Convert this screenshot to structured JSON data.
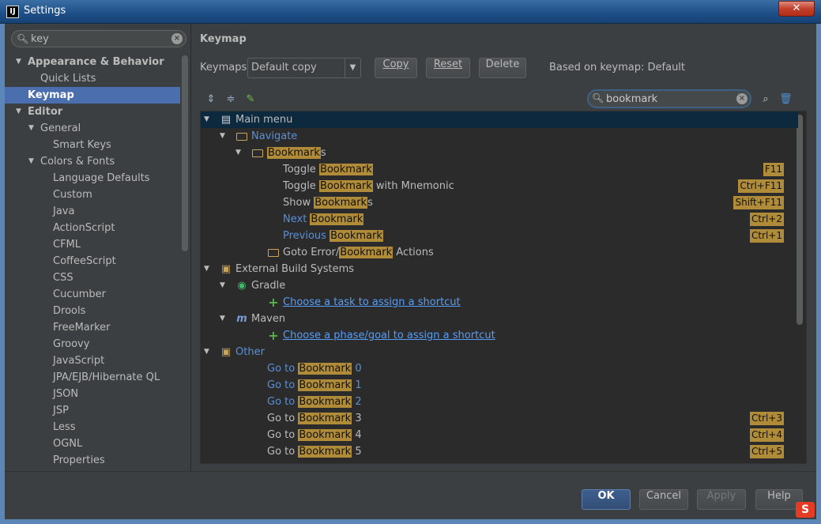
{
  "window": {
    "title": "Settings",
    "close_label": "✕"
  },
  "left": {
    "search_value": "key",
    "tree": [
      {
        "label": "Appearance & Behavior",
        "level": 0,
        "expanded": true,
        "bold": true
      },
      {
        "label": "Quick Lists",
        "level": 1
      },
      {
        "label": "Keymap",
        "level": 0,
        "bold": true,
        "selected": true
      },
      {
        "label": "Editor",
        "level": 0,
        "expanded": true,
        "bold": true
      },
      {
        "label": "General",
        "level": 1,
        "expanded": true
      },
      {
        "label": "Smart Keys",
        "level": 2
      },
      {
        "label": "Colors & Fonts",
        "level": 1,
        "expanded": true
      },
      {
        "label": "Language Defaults",
        "level": 2
      },
      {
        "label": "Custom",
        "level": 2
      },
      {
        "label": "Java",
        "level": 2
      },
      {
        "label": "ActionScript",
        "level": 2
      },
      {
        "label": "CFML",
        "level": 2
      },
      {
        "label": "CoffeeScript",
        "level": 2
      },
      {
        "label": "CSS",
        "level": 2
      },
      {
        "label": "Cucumber",
        "level": 2
      },
      {
        "label": "Drools",
        "level": 2
      },
      {
        "label": "FreeMarker",
        "level": 2
      },
      {
        "label": "Groovy",
        "level": 2
      },
      {
        "label": "JavaScript",
        "level": 2
      },
      {
        "label": "JPA/EJB/Hibernate QL",
        "level": 2
      },
      {
        "label": "JSON",
        "level": 2
      },
      {
        "label": "JSP",
        "level": 2
      },
      {
        "label": "Less",
        "level": 2
      },
      {
        "label": "OGNL",
        "level": 2
      },
      {
        "label": "Properties",
        "level": 2
      }
    ]
  },
  "right": {
    "heading": "Keymap",
    "keymaps_label": "Keymaps:",
    "keymap_selected": "Default copy",
    "copy_label": "Copy",
    "reset_label": "Reset",
    "delete_label": "Delete",
    "based_on": "Based on keymap: Default",
    "search_value": "bookmark",
    "tree": [
      {
        "level": 0,
        "arrow": true,
        "icon": "menu",
        "parts": [
          {
            "t": "Main menu"
          }
        ],
        "selected": true
      },
      {
        "level": 1,
        "arrow": true,
        "icon": "folder",
        "blue": true,
        "parts": [
          {
            "t": "Navigate"
          }
        ]
      },
      {
        "level": 2,
        "arrow": true,
        "icon": "folder",
        "parts": [
          {
            "t": "Bookmark",
            "hl": true
          },
          {
            "t": "s"
          }
        ]
      },
      {
        "level": 4,
        "parts": [
          {
            "t": "Toggle "
          },
          {
            "t": "Bookmark",
            "hl": true
          }
        ],
        "shortcut": "F11"
      },
      {
        "level": 4,
        "parts": [
          {
            "t": "Toggle "
          },
          {
            "t": "Bookmark",
            "hl": true
          },
          {
            "t": " with Mnemonic"
          }
        ],
        "shortcut": "Ctrl+F11"
      },
      {
        "level": 4,
        "parts": [
          {
            "t": "Show "
          },
          {
            "t": "Bookmark",
            "hl": true
          },
          {
            "t": "s"
          }
        ],
        "shortcut": "Shift+F11"
      },
      {
        "level": 4,
        "blue": true,
        "parts": [
          {
            "t": "Next "
          },
          {
            "t": "Bookmark",
            "hl": true
          }
        ],
        "shortcut": "Ctrl+2"
      },
      {
        "level": 4,
        "blue": true,
        "parts": [
          {
            "t": "Previous "
          },
          {
            "t": "Bookmark",
            "hl": true
          }
        ],
        "shortcut": "Ctrl+1"
      },
      {
        "level": 3,
        "icon": "folder",
        "parts": [
          {
            "t": "Goto Error/"
          },
          {
            "t": "Bookmark",
            "hl": true
          },
          {
            "t": " Actions"
          }
        ]
      },
      {
        "level": 0,
        "arrow": true,
        "icon": "build",
        "parts": [
          {
            "t": "External Build Systems"
          }
        ]
      },
      {
        "level": 1,
        "arrow": true,
        "icon": "gradle",
        "parts": [
          {
            "t": "Gradle"
          }
        ]
      },
      {
        "level": 3,
        "icon": "plus",
        "link": true,
        "parts": [
          {
            "t": "Choose a task to assign a shortcut"
          }
        ]
      },
      {
        "level": 1,
        "arrow": true,
        "icon": "maven",
        "parts": [
          {
            "t": "Maven"
          }
        ]
      },
      {
        "level": 3,
        "icon": "plus",
        "link": true,
        "parts": [
          {
            "t": "Choose a phase/goal to assign a shortcut"
          }
        ]
      },
      {
        "level": 0,
        "arrow": true,
        "icon": "other",
        "blue": true,
        "parts": [
          {
            "t": "Other"
          }
        ]
      },
      {
        "level": 3,
        "blue": true,
        "parts": [
          {
            "t": "Go to "
          },
          {
            "t": "Bookmark",
            "hl": true
          },
          {
            "t": " 0"
          }
        ]
      },
      {
        "level": 3,
        "blue": true,
        "parts": [
          {
            "t": "Go to "
          },
          {
            "t": "Bookmark",
            "hl": true
          },
          {
            "t": " 1"
          }
        ]
      },
      {
        "level": 3,
        "blue": true,
        "parts": [
          {
            "t": "Go to "
          },
          {
            "t": "Bookmark",
            "hl": true
          },
          {
            "t": " 2"
          }
        ]
      },
      {
        "level": 3,
        "parts": [
          {
            "t": "Go to "
          },
          {
            "t": "Bookmark",
            "hl": true
          },
          {
            "t": " 3"
          }
        ],
        "shortcut": "Ctrl+3"
      },
      {
        "level": 3,
        "parts": [
          {
            "t": "Go to "
          },
          {
            "t": "Bookmark",
            "hl": true
          },
          {
            "t": " 4"
          }
        ],
        "shortcut": "Ctrl+4"
      },
      {
        "level": 3,
        "parts": [
          {
            "t": "Go to "
          },
          {
            "t": "Bookmark",
            "hl": true
          },
          {
            "t": " 5"
          }
        ],
        "shortcut": "Ctrl+5"
      }
    ]
  },
  "footer": {
    "ok_label": "OK",
    "cancel_label": "Cancel",
    "apply_label": "Apply",
    "help_label": "Help",
    "ime_label": "S"
  },
  "colors": {
    "highlight": "#b08c38",
    "selection": "#4b6eaf",
    "link": "#589df6"
  }
}
